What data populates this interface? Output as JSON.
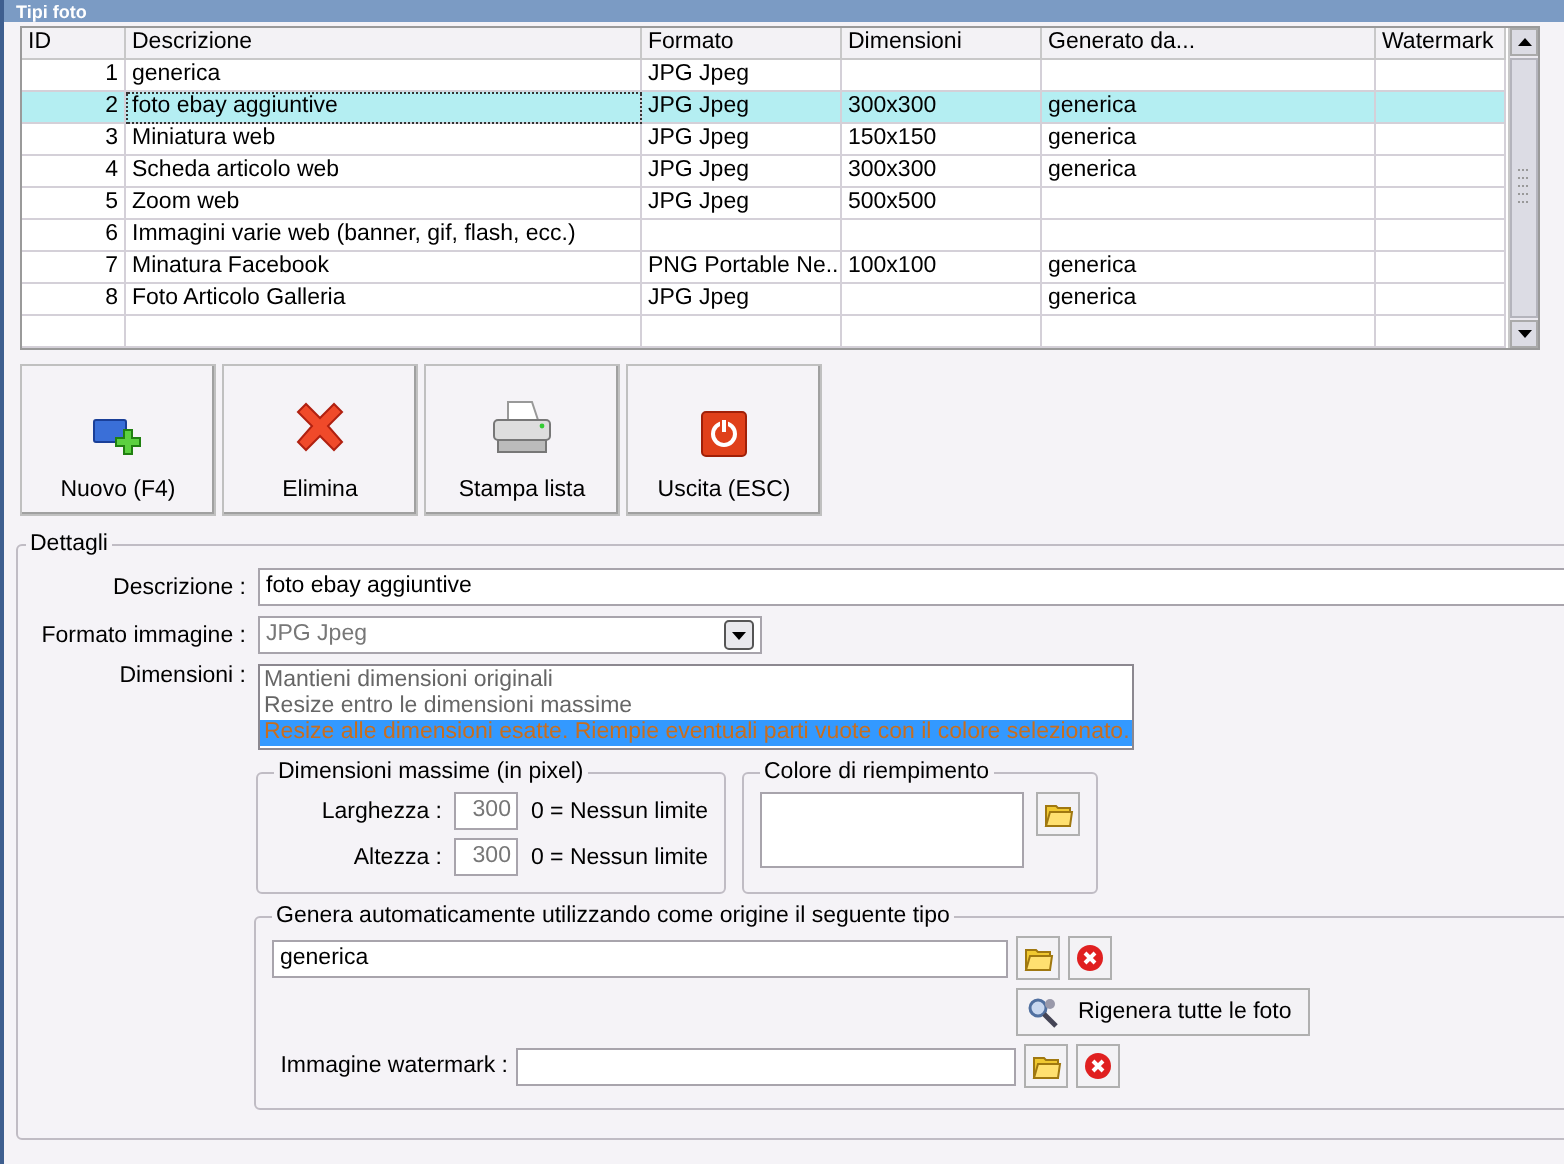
{
  "window": {
    "title": "Tipi foto"
  },
  "table": {
    "columns": [
      "ID",
      "Descrizione",
      "Formato",
      "Dimensioni",
      "Generato da...",
      "Watermark"
    ],
    "rows": [
      {
        "cells": [
          "1",
          "generica",
          "JPG Jpeg",
          "",
          "",
          ""
        ],
        "selected": false
      },
      {
        "cells": [
          "2",
          "foto ebay aggiuntive",
          "JPG Jpeg",
          "300x300",
          "generica",
          ""
        ],
        "selected": true
      },
      {
        "cells": [
          "3",
          "Miniatura web",
          "JPG Jpeg",
          "150x150",
          "generica",
          ""
        ],
        "selected": false
      },
      {
        "cells": [
          "4",
          "Scheda articolo web",
          "JPG Jpeg",
          "300x300",
          "generica",
          ""
        ],
        "selected": false
      },
      {
        "cells": [
          "5",
          "Zoom web",
          "JPG Jpeg",
          "500x500",
          "",
          ""
        ],
        "selected": false
      },
      {
        "cells": [
          "6",
          "Immagini varie web (banner, gif, flash, ecc.)",
          "",
          "",
          "",
          ""
        ],
        "selected": false
      },
      {
        "cells": [
          "7",
          "Minatura Facebook",
          "PNG Portable Ne...",
          "100x100",
          "generica",
          ""
        ],
        "selected": false
      },
      {
        "cells": [
          "8",
          "Foto Articolo Galleria",
          "JPG Jpeg",
          "",
          "generica",
          ""
        ],
        "selected": false
      }
    ]
  },
  "toolbar": [
    {
      "label": "Nuovo (F4)",
      "kind": "new"
    },
    {
      "label": "Elimina",
      "kind": "delete"
    },
    {
      "label": "Stampa lista",
      "kind": "print"
    },
    {
      "label": "Uscita (ESC)",
      "kind": "exit"
    }
  ],
  "details": {
    "title": "Dettagli",
    "description": {
      "label": "Descrizione :",
      "value": "foto ebay aggiuntive"
    },
    "format": {
      "label": "Formato immagine :",
      "value": "JPG Jpeg"
    },
    "dimensions": {
      "label": "Dimensioni :",
      "options": [
        {
          "label": "Mantieni dimensioni originali",
          "selected": false
        },
        {
          "label": "Resize entro le dimensioni massime",
          "selected": false
        },
        {
          "label": "Resize alle dimensioni esatte. Riempie eventuali parti vuote con il colore selezionato.",
          "selected": true
        }
      ]
    },
    "max_size": {
      "title": "Dimensioni massime (in pixel)",
      "fields": [
        {
          "label": "Larghezza :",
          "value": "300",
          "hint": "0 = Nessun limite"
        },
        {
          "label": "Altezza :",
          "value": "300",
          "hint": "0 = Nessun limite"
        }
      ]
    },
    "fill_color": {
      "title": "Colore di riempimento"
    },
    "source": {
      "title": "Genera automaticamente utilizzando come origine il seguente tipo",
      "value": "generica",
      "regenerate_button": "Rigenera tutte le foto",
      "watermark_label": "Immagine watermark :"
    }
  }
}
